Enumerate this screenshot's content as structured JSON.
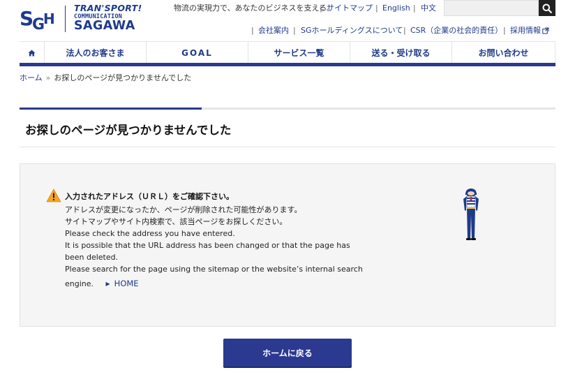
{
  "logo": {
    "monogram": "SGH",
    "line1": "TRAN'SPORT!",
    "line2": "COMMUNICATION",
    "line3": "SAGAWA"
  },
  "header": {
    "tagline": "物流の実現力で、あなたのビジネスを支える。",
    "sep": "|",
    "top_links": [
      "サイトマップ",
      "English",
      "中文"
    ],
    "sub_links": [
      "会社案内",
      "SGホールディングスについて",
      "CSR（企業の社会的責任）",
      "採用情報"
    ]
  },
  "search": {
    "icon": "search-icon",
    "placeholder": ""
  },
  "nav": {
    "home_icon": "home-icon",
    "items": [
      "法人のお客さま",
      "GOAL",
      "サービス一覧",
      "送る・受け取る",
      "お問い合わせ"
    ]
  },
  "breadcrumb": {
    "home": "ホーム",
    "sep": "»",
    "current": "お探しのページが見つかりませんでした"
  },
  "page": {
    "title": "お探しのページが見つかりませんでした"
  },
  "message": {
    "heading": "入力されたアドレス（ＵＲＬ）をご確認下さい。",
    "lines": [
      "アドレスが変更になったか、ページが削除された可能性があります。",
      "サイトマップやサイト内検索で、該当ページをお探しください。",
      "Please check the address you have entered.",
      "It is possible that the URL address has been changed or that the page has",
      "been deleted.",
      "Please search for the page using the sitemap or the website’s internal search"
    ],
    "last_line": "engine.",
    "home_link": "HOME"
  },
  "button": {
    "back_home": "ホームに戻る"
  },
  "colors": {
    "brand": "#2b3990",
    "link": "#1e3a8a",
    "warning": "#f5a623"
  }
}
